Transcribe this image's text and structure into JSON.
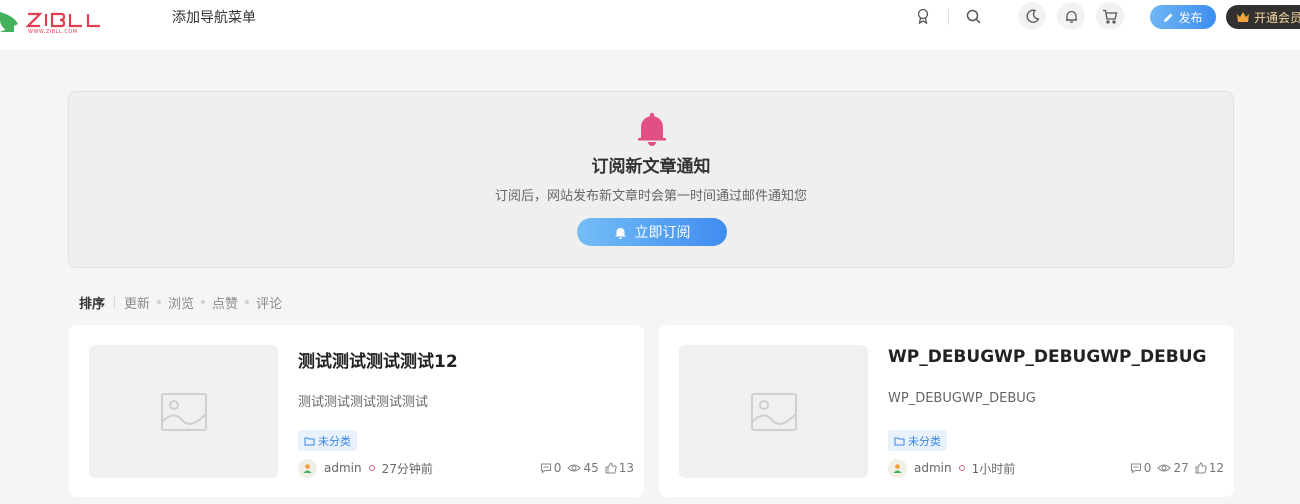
{
  "header": {
    "logo_alt": "ZIBLL",
    "nav_item": "添加导航菜单",
    "publish_label": "发布",
    "vip_label": "开通会员"
  },
  "subscribe": {
    "title": "订阅新文章通知",
    "description": "订阅后，网站发布新文章时会第一时间通过邮件通知您",
    "button_label": "立即订阅"
  },
  "sortbar": {
    "label": "排序",
    "options": [
      "更新",
      "浏览",
      "点赞",
      "评论"
    ]
  },
  "posts": [
    {
      "title": "测试测试测试测试12",
      "excerpt": "测试测试测试测试测试",
      "category": "未分类",
      "author": "admin",
      "time": "27分钟前",
      "comments": "0",
      "views": "45",
      "likes": "13"
    },
    {
      "title": "WP_DEBUGWP_DEBUGWP_DEBUG",
      "excerpt": "WP_DEBUGWP_DEBUG",
      "category": "未分类",
      "author": "admin",
      "time": "1小时前",
      "comments": "0",
      "views": "27",
      "likes": "12"
    }
  ],
  "colors": {
    "accent_blue": "#3d8ef0",
    "bell_pink": "#e24f84",
    "logo_red": "#e03f4f",
    "logo_green": "#43b05c"
  },
  "icons": [
    "logo",
    "badge-icon",
    "search-icon",
    "moon-icon",
    "bell-icon",
    "cart-icon",
    "pencil-icon",
    "crown-icon",
    "image-placeholder-icon",
    "folder-icon",
    "comment-icon",
    "eye-icon",
    "thumbs-up-icon"
  ]
}
